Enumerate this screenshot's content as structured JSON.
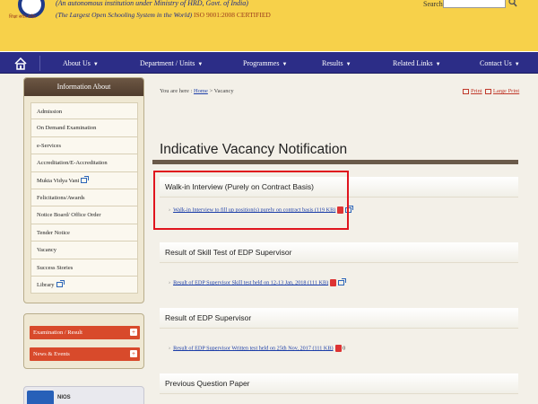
{
  "header": {
    "logo_tag": "शिक्षा सर्वत्र सदैव",
    "line1": "(An autonomous institution under  Ministry of HRD, Govt. of India)",
    "line2": "(The Largest Open Schooling System in the World)",
    "iso": "ISO 9001:2008 CERTIFIED",
    "search_label": "Search:",
    "search_value": ""
  },
  "nav": {
    "items": [
      "About Us",
      "Department / Units",
      "Programmes",
      "Results",
      "Related Links",
      "Contact Us"
    ]
  },
  "sidebar": {
    "heading": "Information About",
    "items": [
      {
        "label": "Admission",
        "ext": false
      },
      {
        "label": "On Demand Examination",
        "ext": false
      },
      {
        "label": "e-Services",
        "ext": false
      },
      {
        "label": "Accreditation/E-Accreditation",
        "ext": false
      },
      {
        "label": "Mukta Vidya Vani",
        "ext": true
      },
      {
        "label": "Felicitations/Awards",
        "ext": false
      },
      {
        "label": "Notice Board/ Office Order",
        "ext": false
      },
      {
        "label": "Tender Notice",
        "ext": false
      },
      {
        "label": "Vacancy",
        "ext": false
      },
      {
        "label": "Success Stories",
        "ext": false
      },
      {
        "label": "Library",
        "ext": true
      }
    ]
  },
  "panel2": {
    "btn1": "Examination / Result",
    "btn2": "News & Events"
  },
  "panel3": {
    "label": "NIOS"
  },
  "breadcrumb": {
    "prefix": "You are here :",
    "home": "Home",
    "sep": ">",
    "current": "Vacancy"
  },
  "tools": {
    "print": "Print",
    "large_print": "Large Print"
  },
  "page_title": "Indicative Vacancy Notification",
  "sections": [
    {
      "heading": "Walk-in Interview (Purely on Contract Basis)",
      "link": "Walk-in Interview to fill up position(s) purely on contract basis (119 KB)",
      "suffix": ""
    },
    {
      "heading": "Result of Skill Test of EDP Supervisor",
      "link": "Result of EDP Supervisor Skill test held on 12-13 Jan, 2018 (111 KB)",
      "suffix": ""
    },
    {
      "heading": "Result of EDP Supervisor",
      "link": "Result of EDP Supervisor Written test held on 25th Nov, 2017 (111 KB)",
      "suffix": "0"
    },
    {
      "heading": "Previous Question Paper",
      "link": "",
      "suffix": ""
    }
  ]
}
